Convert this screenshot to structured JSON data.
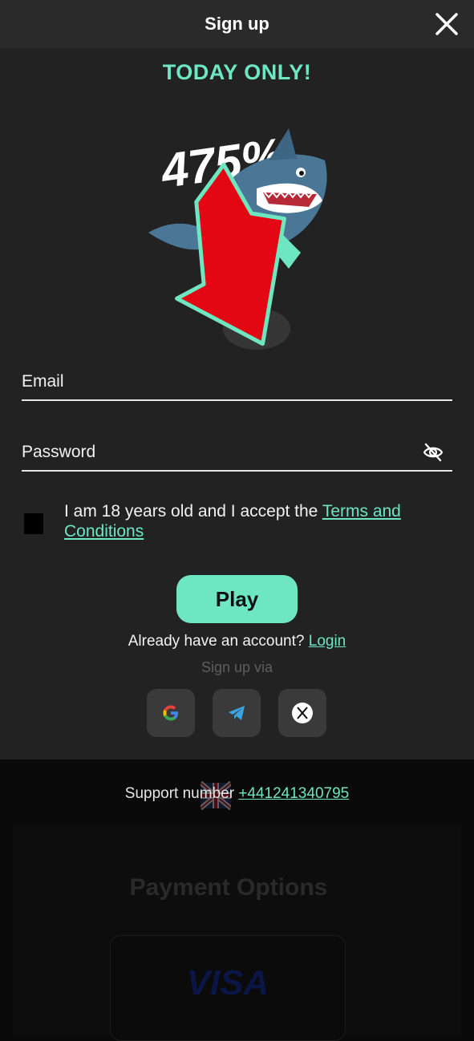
{
  "header": {
    "title": "Sign up"
  },
  "promo": {
    "title": "TODAY ONLY!",
    "bonus": "475%"
  },
  "form": {
    "email_placeholder": "Email",
    "password_placeholder": "Password",
    "consent_text": "I am 18 years old and I accept the ",
    "terms_link": "Terms and Conditions",
    "play_label": "Play",
    "account_text": "Already have an account? ",
    "login_link": "Login",
    "signup_via": "Sign up via"
  },
  "social": [
    {
      "icon": "google-icon"
    },
    {
      "icon": "telegram-icon"
    },
    {
      "icon": "x-icon"
    }
  ],
  "footer": {
    "support_label": "Support number ",
    "support_phone": "+441241340795",
    "payment_title": "Payment Options",
    "visa_label": "VISA"
  },
  "colors": {
    "accent": "#6ee7c1",
    "header_bg": "#2a2a2a",
    "panel_bg": "#222222",
    "page_bg": "#0a0a0a"
  }
}
